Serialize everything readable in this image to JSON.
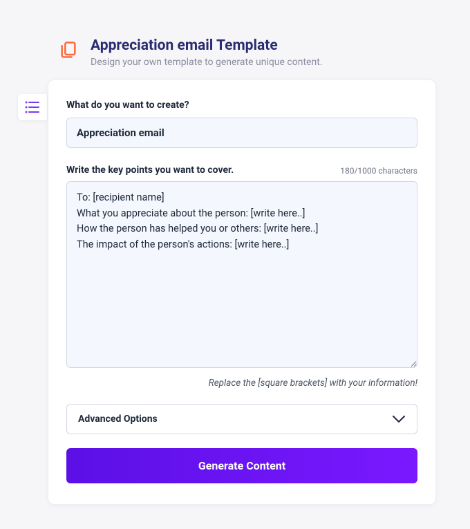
{
  "header": {
    "title": "Appreciation email Template",
    "subtitle": "Design your own template to generate unique content."
  },
  "form": {
    "create_label": "What do you want to create?",
    "create_value": "Appreciation email",
    "keypoints_label": "Write the key points you want to cover.",
    "char_counter": "180/1000 characters",
    "keypoints_value": "To: [recipient name]\nWhat you appreciate about the person: [write here..]\nHow the person has helped you or others: [write here..]\nThe impact of the person's actions: [write here..]",
    "helper": "Replace the [square brackets] with your information!",
    "advanced_label": "Advanced Options",
    "generate_label": "Generate Content"
  },
  "colors": {
    "accent_icon": "#ff6b3d",
    "sidebar_icon": "#7c3aed",
    "heading": "#2a2b70",
    "button_start": "#5b10e6",
    "button_end": "#7a18ff"
  }
}
